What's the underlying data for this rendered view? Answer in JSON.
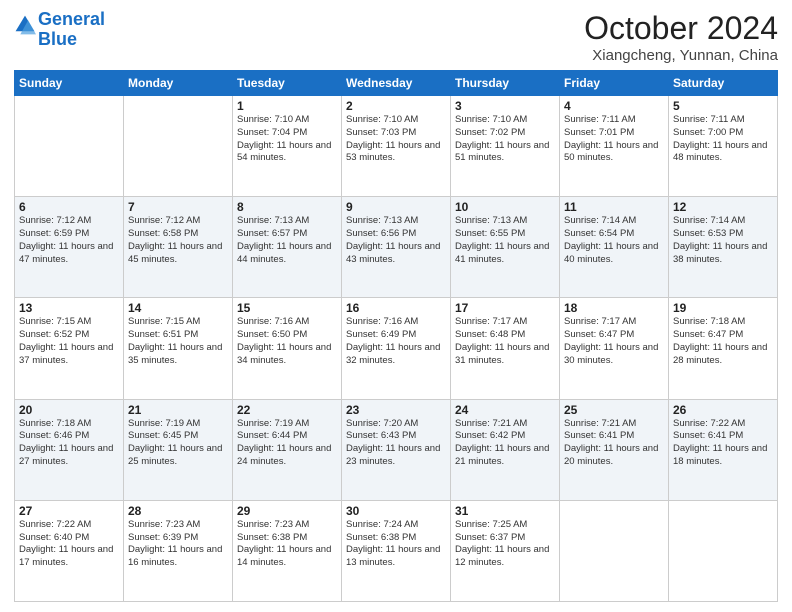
{
  "header": {
    "logo_line1": "General",
    "logo_line2": "Blue",
    "month": "October 2024",
    "location": "Xiangcheng, Yunnan, China"
  },
  "weekdays": [
    "Sunday",
    "Monday",
    "Tuesday",
    "Wednesday",
    "Thursday",
    "Friday",
    "Saturday"
  ],
  "weeks": [
    [
      null,
      null,
      {
        "day": "1",
        "sunrise": "Sunrise: 7:10 AM",
        "sunset": "Sunset: 7:04 PM",
        "daylight": "Daylight: 11 hours and 54 minutes."
      },
      {
        "day": "2",
        "sunrise": "Sunrise: 7:10 AM",
        "sunset": "Sunset: 7:03 PM",
        "daylight": "Daylight: 11 hours and 53 minutes."
      },
      {
        "day": "3",
        "sunrise": "Sunrise: 7:10 AM",
        "sunset": "Sunset: 7:02 PM",
        "daylight": "Daylight: 11 hours and 51 minutes."
      },
      {
        "day": "4",
        "sunrise": "Sunrise: 7:11 AM",
        "sunset": "Sunset: 7:01 PM",
        "daylight": "Daylight: 11 hours and 50 minutes."
      },
      {
        "day": "5",
        "sunrise": "Sunrise: 7:11 AM",
        "sunset": "Sunset: 7:00 PM",
        "daylight": "Daylight: 11 hours and 48 minutes."
      }
    ],
    [
      {
        "day": "6",
        "sunrise": "Sunrise: 7:12 AM",
        "sunset": "Sunset: 6:59 PM",
        "daylight": "Daylight: 11 hours and 47 minutes."
      },
      {
        "day": "7",
        "sunrise": "Sunrise: 7:12 AM",
        "sunset": "Sunset: 6:58 PM",
        "daylight": "Daylight: 11 hours and 45 minutes."
      },
      {
        "day": "8",
        "sunrise": "Sunrise: 7:13 AM",
        "sunset": "Sunset: 6:57 PM",
        "daylight": "Daylight: 11 hours and 44 minutes."
      },
      {
        "day": "9",
        "sunrise": "Sunrise: 7:13 AM",
        "sunset": "Sunset: 6:56 PM",
        "daylight": "Daylight: 11 hours and 43 minutes."
      },
      {
        "day": "10",
        "sunrise": "Sunrise: 7:13 AM",
        "sunset": "Sunset: 6:55 PM",
        "daylight": "Daylight: 11 hours and 41 minutes."
      },
      {
        "day": "11",
        "sunrise": "Sunrise: 7:14 AM",
        "sunset": "Sunset: 6:54 PM",
        "daylight": "Daylight: 11 hours and 40 minutes."
      },
      {
        "day": "12",
        "sunrise": "Sunrise: 7:14 AM",
        "sunset": "Sunset: 6:53 PM",
        "daylight": "Daylight: 11 hours and 38 minutes."
      }
    ],
    [
      {
        "day": "13",
        "sunrise": "Sunrise: 7:15 AM",
        "sunset": "Sunset: 6:52 PM",
        "daylight": "Daylight: 11 hours and 37 minutes."
      },
      {
        "day": "14",
        "sunrise": "Sunrise: 7:15 AM",
        "sunset": "Sunset: 6:51 PM",
        "daylight": "Daylight: 11 hours and 35 minutes."
      },
      {
        "day": "15",
        "sunrise": "Sunrise: 7:16 AM",
        "sunset": "Sunset: 6:50 PM",
        "daylight": "Daylight: 11 hours and 34 minutes."
      },
      {
        "day": "16",
        "sunrise": "Sunrise: 7:16 AM",
        "sunset": "Sunset: 6:49 PM",
        "daylight": "Daylight: 11 hours and 32 minutes."
      },
      {
        "day": "17",
        "sunrise": "Sunrise: 7:17 AM",
        "sunset": "Sunset: 6:48 PM",
        "daylight": "Daylight: 11 hours and 31 minutes."
      },
      {
        "day": "18",
        "sunrise": "Sunrise: 7:17 AM",
        "sunset": "Sunset: 6:47 PM",
        "daylight": "Daylight: 11 hours and 30 minutes."
      },
      {
        "day": "19",
        "sunrise": "Sunrise: 7:18 AM",
        "sunset": "Sunset: 6:47 PM",
        "daylight": "Daylight: 11 hours and 28 minutes."
      }
    ],
    [
      {
        "day": "20",
        "sunrise": "Sunrise: 7:18 AM",
        "sunset": "Sunset: 6:46 PM",
        "daylight": "Daylight: 11 hours and 27 minutes."
      },
      {
        "day": "21",
        "sunrise": "Sunrise: 7:19 AM",
        "sunset": "Sunset: 6:45 PM",
        "daylight": "Daylight: 11 hours and 25 minutes."
      },
      {
        "day": "22",
        "sunrise": "Sunrise: 7:19 AM",
        "sunset": "Sunset: 6:44 PM",
        "daylight": "Daylight: 11 hours and 24 minutes."
      },
      {
        "day": "23",
        "sunrise": "Sunrise: 7:20 AM",
        "sunset": "Sunset: 6:43 PM",
        "daylight": "Daylight: 11 hours and 23 minutes."
      },
      {
        "day": "24",
        "sunrise": "Sunrise: 7:21 AM",
        "sunset": "Sunset: 6:42 PM",
        "daylight": "Daylight: 11 hours and 21 minutes."
      },
      {
        "day": "25",
        "sunrise": "Sunrise: 7:21 AM",
        "sunset": "Sunset: 6:41 PM",
        "daylight": "Daylight: 11 hours and 20 minutes."
      },
      {
        "day": "26",
        "sunrise": "Sunrise: 7:22 AM",
        "sunset": "Sunset: 6:41 PM",
        "daylight": "Daylight: 11 hours and 18 minutes."
      }
    ],
    [
      {
        "day": "27",
        "sunrise": "Sunrise: 7:22 AM",
        "sunset": "Sunset: 6:40 PM",
        "daylight": "Daylight: 11 hours and 17 minutes."
      },
      {
        "day": "28",
        "sunrise": "Sunrise: 7:23 AM",
        "sunset": "Sunset: 6:39 PM",
        "daylight": "Daylight: 11 hours and 16 minutes."
      },
      {
        "day": "29",
        "sunrise": "Sunrise: 7:23 AM",
        "sunset": "Sunset: 6:38 PM",
        "daylight": "Daylight: 11 hours and 14 minutes."
      },
      {
        "day": "30",
        "sunrise": "Sunrise: 7:24 AM",
        "sunset": "Sunset: 6:38 PM",
        "daylight": "Daylight: 11 hours and 13 minutes."
      },
      {
        "day": "31",
        "sunrise": "Sunrise: 7:25 AM",
        "sunset": "Sunset: 6:37 PM",
        "daylight": "Daylight: 11 hours and 12 minutes."
      },
      null,
      null
    ]
  ]
}
